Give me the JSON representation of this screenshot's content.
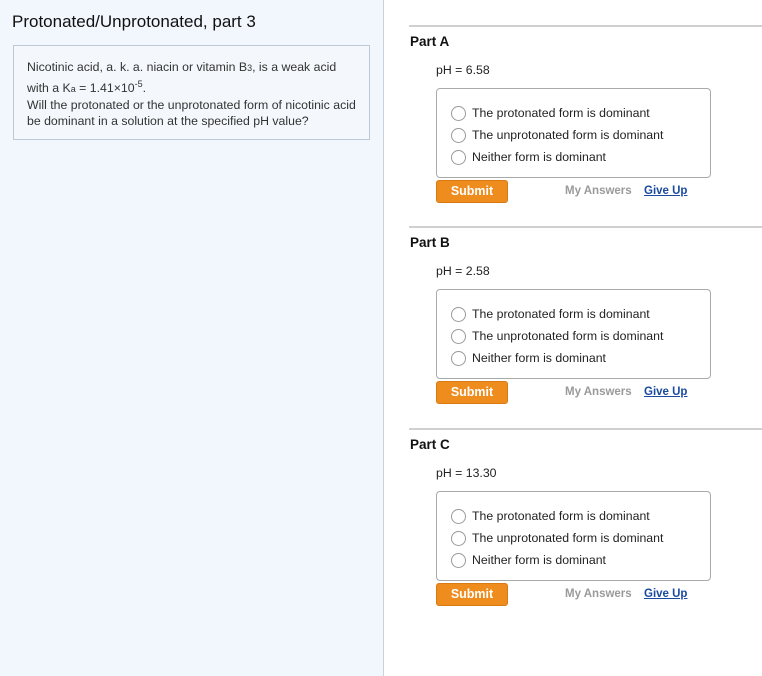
{
  "page_title": "Protonated/Unprotonated, part 3",
  "intro": {
    "line1": "Nicotinic acid, a. k. a. niacin or vitamin B",
    "b_sub": "3",
    "line1_end": ", is a weak acid",
    "line2_pre": "with a K",
    "ka_sub": "a",
    "line2_mid": " = 1.41×10",
    "exp": "-5",
    "line2_end": ".",
    "question": "Will the protonated or the unprotonated form of nicotinic acid be dominant in a solution at the specified pH value?"
  },
  "options": [
    "The protonated form is dominant",
    "The unprotonated form is dominant",
    "Neither form is dominant"
  ],
  "submit_label": "Submit",
  "my_answers_label": "My Answers",
  "give_up_label": "Give Up",
  "parts": [
    {
      "label": "Part A",
      "ph": "pH = 6.58"
    },
    {
      "label": "Part B",
      "ph": "pH = 2.58"
    },
    {
      "label": "Part C",
      "ph": "pH = 13.30"
    }
  ]
}
